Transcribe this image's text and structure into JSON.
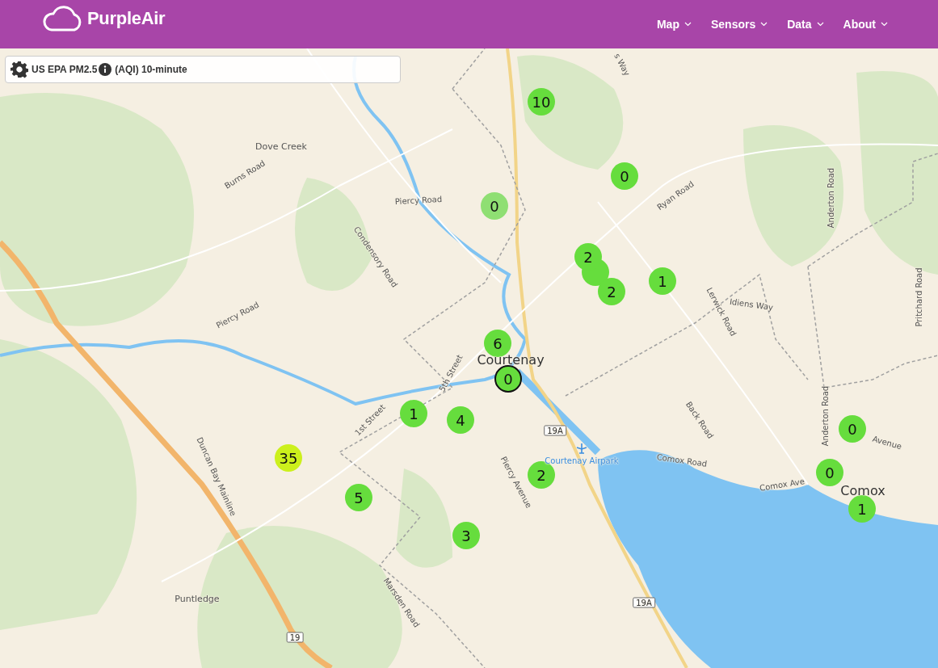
{
  "header": {
    "brand": "PurpleAir",
    "nav": [
      {
        "label": "Map"
      },
      {
        "label": "Sensors"
      },
      {
        "label": "Data"
      },
      {
        "label": "About"
      }
    ]
  },
  "layer_selector": {
    "metric": "US EPA PM2.5",
    "averaging": "(AQI) 10-minute"
  },
  "map": {
    "labels": [
      {
        "text": "s Way",
        "kind": "road"
      },
      {
        "text": "Dove Creek",
        "kind": "place"
      },
      {
        "text": "Burns Road",
        "kind": "road"
      },
      {
        "text": "Piercy Road",
        "kind": "road"
      },
      {
        "text": "Condensory Road",
        "kind": "road"
      },
      {
        "text": "Piercy Road",
        "kind": "road"
      },
      {
        "text": "Ryan Road",
        "kind": "road"
      },
      {
        "text": "Anderton Road",
        "kind": "road"
      },
      {
        "text": "Lerwick Road",
        "kind": "road"
      },
      {
        "text": "Idiens Way",
        "kind": "road"
      },
      {
        "text": "Pritchard Road",
        "kind": "road"
      },
      {
        "text": "Courtenay",
        "kind": "city"
      },
      {
        "text": "5th Street",
        "kind": "road"
      },
      {
        "text": "1st Street",
        "kind": "road"
      },
      {
        "text": "19A",
        "kind": "shield"
      },
      {
        "text": "Courtenay Airpark",
        "kind": "airport"
      },
      {
        "text": "Piercy Avenue",
        "kind": "road"
      },
      {
        "text": "Back Road",
        "kind": "road"
      },
      {
        "text": "Comox Road",
        "kind": "road"
      },
      {
        "text": "Anderton Road",
        "kind": "road"
      },
      {
        "text": "Avenue",
        "kind": "road"
      },
      {
        "text": "Comox Ave",
        "kind": "road"
      },
      {
        "text": "Comox",
        "kind": "city"
      },
      {
        "text": "Duncan Bay Mainline",
        "kind": "road"
      },
      {
        "text": "Marsden Road",
        "kind": "road"
      },
      {
        "text": "Puntledge",
        "kind": "place"
      },
      {
        "text": "19A",
        "kind": "shield"
      },
      {
        "text": "19",
        "kind": "shield"
      }
    ],
    "markers": [
      {
        "value": "10",
        "color": "#66dd3d",
        "selected": false
      },
      {
        "value": "0",
        "color": "#66dd3d",
        "selected": false
      },
      {
        "value": "0",
        "color": "#8fdf73",
        "selected": false
      },
      {
        "color": "#66dd3d",
        "selected": false
      },
      {
        "value": "2",
        "color": "#66dd3d",
        "selected": false
      },
      {
        "value": "2",
        "color": "#66dd3d",
        "selected": false
      },
      {
        "value": "1",
        "color": "#66dd3d",
        "selected": false
      },
      {
        "value": "6",
        "color": "#66dd3d",
        "selected": false
      },
      {
        "value": "0",
        "color": "#66dd3d",
        "selected": true
      },
      {
        "value": "1",
        "color": "#66dd3d",
        "selected": false
      },
      {
        "value": "4",
        "color": "#66dd3d",
        "selected": false
      },
      {
        "value": "35",
        "color": "#ccf01c",
        "selected": false
      },
      {
        "value": "5",
        "color": "#66dd3d",
        "selected": false
      },
      {
        "value": "2",
        "color": "#66dd3d",
        "selected": false
      },
      {
        "value": "3",
        "color": "#66dd3d",
        "selected": false
      },
      {
        "value": "0",
        "color": "#66dd3d",
        "selected": false
      },
      {
        "value": "0",
        "color": "#66dd3d",
        "selected": false
      },
      {
        "value": "1",
        "color": "#66dd3d",
        "selected": false
      }
    ]
  }
}
